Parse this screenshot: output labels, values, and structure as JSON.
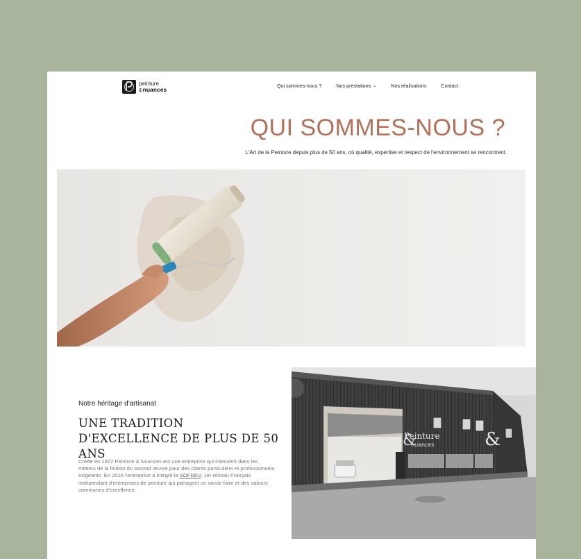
{
  "header": {
    "logo_line1": "peinture",
    "logo_amp": "&",
    "logo_line2": "nuances",
    "nav": [
      {
        "label": "Qui sommes-nous ?"
      },
      {
        "label": "Nos prestations",
        "chevron": "chevron-down-icon"
      },
      {
        "label": "Nos réalisations"
      },
      {
        "label": "Contact"
      }
    ]
  },
  "hero": {
    "title": "QUI SOMMES-NOUS ?",
    "subtitle": "L'Art de la Peinture depuis plus de 50 ans, où qualité, expertise et respect de l'environnement se rencontrent."
  },
  "section": {
    "kicker": "Notre héritage d'artisanat",
    "title": "UNE TRADITION D'EXCELLENCE DE PLUS DE 50 ANS",
    "body_before": "Créée en 1972 Peinture & Nuances est une entreprise qui intervient dans les métiers de la finition du second œuvre pour des clients particuliers et professionnels exigeants. En 2016 l'entreprise à intégré la ",
    "body_link": "SOFREV",
    "body_after": ", 1er réseau Français indépendant d'entreprises de peinture qui partagent un savoir faire et des valeurs communes d'excellence."
  },
  "building_sign": {
    "line1": "Peinture",
    "line2": "nuances",
    "amp": "&"
  },
  "colors": {
    "background": "#a8b59c",
    "accent": "#b5705a",
    "text_dark": "#1a1a1a"
  }
}
